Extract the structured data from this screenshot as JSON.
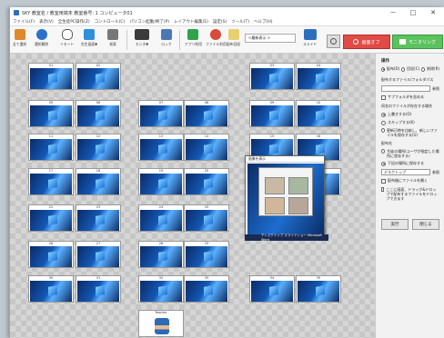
{
  "window": {
    "title": "SKY 教室名 / 教室用端末 教室番号: 1 コンピュータ01",
    "controls": [
      "－",
      "□",
      "✕"
    ]
  },
  "menu": [
    "ファイル(F)",
    "表示(V)",
    "全生徒PC操作(Z)",
    "コントロール(C)",
    "パソコン起動/終了(P)",
    "レイアウト編集(E)",
    "設定(S)",
    "ツール(T)",
    "ヘルプ(H)"
  ],
  "toolbar": {
    "buttons": [
      {
        "label": "全て選択",
        "color": "#e0892a"
      },
      {
        "label": "選択解除",
        "color": "#2a73c9"
      },
      {
        "label": "リモート",
        "color": "#3a3a3a"
      },
      {
        "label": "先生画面▼",
        "color": "#2f8fd8"
      },
      {
        "label": "発表",
        "color": "#777777"
      },
      {
        "label": "モニタ▼",
        "color": "#3b3b3b"
      },
      {
        "label": "ロック",
        "color": "#4a78b5"
      },
      {
        "label": "アプリ利用",
        "color": "#31a24c"
      },
      {
        "label": "ファイル利用",
        "color": "#d84a3a"
      },
      {
        "label": "配布回収",
        "color": "#e8d070"
      }
    ],
    "dropdown": "<最新表示 >",
    "slide_label": "スライド",
    "screen_off_label": "画面オフ",
    "monitoring_label": "モニタリング"
  },
  "pcs": [
    {
      "name": "01"
    },
    {
      "name": "02"
    },
    {
      "name": "03"
    },
    {
      "name": "04"
    },
    {
      "name": "05"
    },
    {
      "name": "06"
    },
    {
      "name": "07"
    },
    {
      "name": "08"
    },
    {
      "name": "09"
    },
    {
      "name": "10"
    },
    {
      "name": "11"
    },
    {
      "name": "12"
    },
    {
      "name": "13"
    },
    {
      "name": "14"
    },
    {
      "name": "15"
    },
    {
      "name": "16"
    },
    {
      "name": "17"
    },
    {
      "name": "18"
    },
    {
      "name": "19"
    },
    {
      "name": "20"
    },
    {
      "name": "21"
    },
    {
      "name": "22"
    },
    {
      "name": "23"
    },
    {
      "name": "24"
    },
    {
      "name": "25"
    },
    {
      "name": "26"
    },
    {
      "name": "27"
    },
    {
      "name": "28"
    },
    {
      "name": "29"
    },
    {
      "name": "30"
    },
    {
      "name": "31"
    },
    {
      "name": "32"
    },
    {
      "name": "33"
    },
    {
      "name": "34"
    },
    {
      "name": "35"
    },
    {
      "name": "36"
    },
    {
      "name": "37"
    },
    {
      "name": "38"
    },
    {
      "name": "39"
    },
    {
      "name": "40"
    },
    {
      "name": "41"
    },
    {
      "name": "42"
    },
    {
      "name": "43"
    },
    {
      "name": "44"
    },
    {
      "name": "45"
    },
    {
      "name": "46"
    },
    {
      "name": "47"
    },
    {
      "name": "48"
    },
    {
      "name": "49"
    },
    {
      "name": "50"
    },
    {
      "name": "51"
    },
    {
      "name": "52"
    },
    {
      "name": "53"
    },
    {
      "name": "Teacher"
    }
  ],
  "panel": {
    "operation_title": "操作",
    "op_distribute": "配布(D)",
    "op_collect": "回収(C)",
    "op_delete": "削除(R)",
    "source_label": "配布するファイル/フォルダパス",
    "browse": "参照",
    "include_subfolders": "サブフォルダを含める",
    "same_name_label": "同名のファイルが存在する場合",
    "overwrite": "上書きする(O)",
    "skip": "スキップする(K)",
    "rename": "更新日時を比較し、新しいファイルを保存する(U)",
    "dest_label": "配布先",
    "dest_user": "生徒の場所(ユーザが指定した場所に保存する)",
    "dest_fixed": "下記の場所に保存する",
    "dest_value": "デスクトップ",
    "open_after": "配布後にファイルを開く",
    "drag_note": "ここに画面、ドラッグ&ドロップで配布するファイルをドロップできます",
    "run": "実行",
    "close": "閉じる"
  },
  "dialog": {
    "title": "画像を表示",
    "taskbar_text": "ディスクトップ  スライドショー  Microsoft Word"
  }
}
